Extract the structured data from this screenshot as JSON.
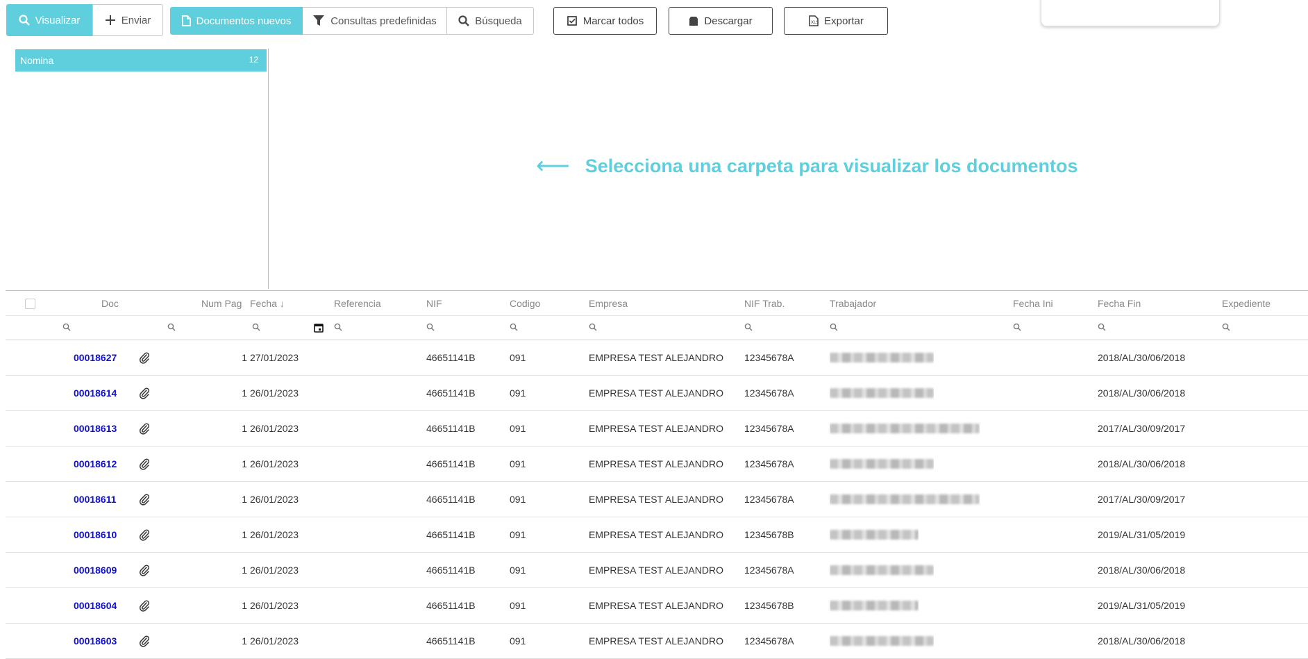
{
  "toolbar": {
    "visualizar": "Visualizar",
    "enviar": "Enviar",
    "documentos_nuevos": "Documentos nuevos",
    "consultas_predefinidas": "Consultas predefinidas",
    "busqueda": "Búsqueda",
    "marcar_todos": "Marcar todos",
    "descargar": "Descargar",
    "exportar": "Exportar"
  },
  "folders": [
    {
      "label": "Nomina",
      "count": "12"
    }
  ],
  "hint": {
    "arrow": "⟵",
    "text": "Selecciona una carpeta para visualizar los documentos"
  },
  "table": {
    "columns": {
      "doc": "Doc",
      "num_pag": "Num Pag",
      "fecha": "Fecha",
      "sort_indicator": "↓",
      "referencia": "Referencia",
      "nif": "NIF",
      "codigo": "Codigo",
      "empresa": "Empresa",
      "nif_trab": "NIF Trab.",
      "trabajador": "Trabajador",
      "fecha_ini": "Fecha Ini",
      "fecha_fin": "Fecha Fin",
      "expediente": "Expediente"
    },
    "rows": [
      {
        "doc": "00018627",
        "num_pag": "1",
        "fecha": "27/01/2023",
        "referencia": "",
        "nif": "46651141B",
        "codigo": "091",
        "empresa": "EMPRESA TEST ALEJANDRO",
        "nif_trab": "12345678A",
        "fecha_ini": "",
        "fecha_fin": "2018/AL/30/06/2018",
        "expediente": ""
      },
      {
        "doc": "00018614",
        "num_pag": "1",
        "fecha": "26/01/2023",
        "referencia": "",
        "nif": "46651141B",
        "codigo": "091",
        "empresa": "EMPRESA TEST ALEJANDRO",
        "nif_trab": "12345678A",
        "fecha_ini": "",
        "fecha_fin": "2018/AL/30/06/2018",
        "expediente": ""
      },
      {
        "doc": "00018613",
        "num_pag": "1",
        "fecha": "26/01/2023",
        "referencia": "",
        "nif": "46651141B",
        "codigo": "091",
        "empresa": "EMPRESA TEST ALEJANDRO",
        "nif_trab": "12345678A",
        "fecha_ini": "",
        "fecha_fin": "2017/AL/30/09/2017",
        "expediente": ""
      },
      {
        "doc": "00018612",
        "num_pag": "1",
        "fecha": "26/01/2023",
        "referencia": "",
        "nif": "46651141B",
        "codigo": "091",
        "empresa": "EMPRESA TEST ALEJANDRO",
        "nif_trab": "12345678A",
        "fecha_ini": "",
        "fecha_fin": "2018/AL/30/06/2018",
        "expediente": ""
      },
      {
        "doc": "00018611",
        "num_pag": "1",
        "fecha": "26/01/2023",
        "referencia": "",
        "nif": "46651141B",
        "codigo": "091",
        "empresa": "EMPRESA TEST ALEJANDRO",
        "nif_trab": "12345678A",
        "fecha_ini": "",
        "fecha_fin": "2017/AL/30/09/2017",
        "expediente": ""
      },
      {
        "doc": "00018610",
        "num_pag": "1",
        "fecha": "26/01/2023",
        "referencia": "",
        "nif": "46651141B",
        "codigo": "091",
        "empresa": "EMPRESA TEST ALEJANDRO",
        "nif_trab": "12345678B",
        "fecha_ini": "",
        "fecha_fin": "2019/AL/31/05/2019",
        "expediente": ""
      },
      {
        "doc": "00018609",
        "num_pag": "1",
        "fecha": "26/01/2023",
        "referencia": "",
        "nif": "46651141B",
        "codigo": "091",
        "empresa": "EMPRESA TEST ALEJANDRO",
        "nif_trab": "12345678A",
        "fecha_ini": "",
        "fecha_fin": "2018/AL/30/06/2018",
        "expediente": ""
      },
      {
        "doc": "00018604",
        "num_pag": "1",
        "fecha": "26/01/2023",
        "referencia": "",
        "nif": "46651141B",
        "codigo": "091",
        "empresa": "EMPRESA TEST ALEJANDRO",
        "nif_trab": "12345678B",
        "fecha_ini": "",
        "fecha_fin": "2019/AL/31/05/2019",
        "expediente": ""
      },
      {
        "doc": "00018603",
        "num_pag": "1",
        "fecha": "26/01/2023",
        "referencia": "",
        "nif": "46651141B",
        "codigo": "091",
        "empresa": "EMPRESA TEST ALEJANDRO",
        "nif_trab": "12345678A",
        "fecha_ini": "",
        "fecha_fin": "2018/AL/30/06/2018",
        "expediente": ""
      }
    ]
  },
  "colors": {
    "accent": "#5fcfdd",
    "link": "#1010d0"
  }
}
